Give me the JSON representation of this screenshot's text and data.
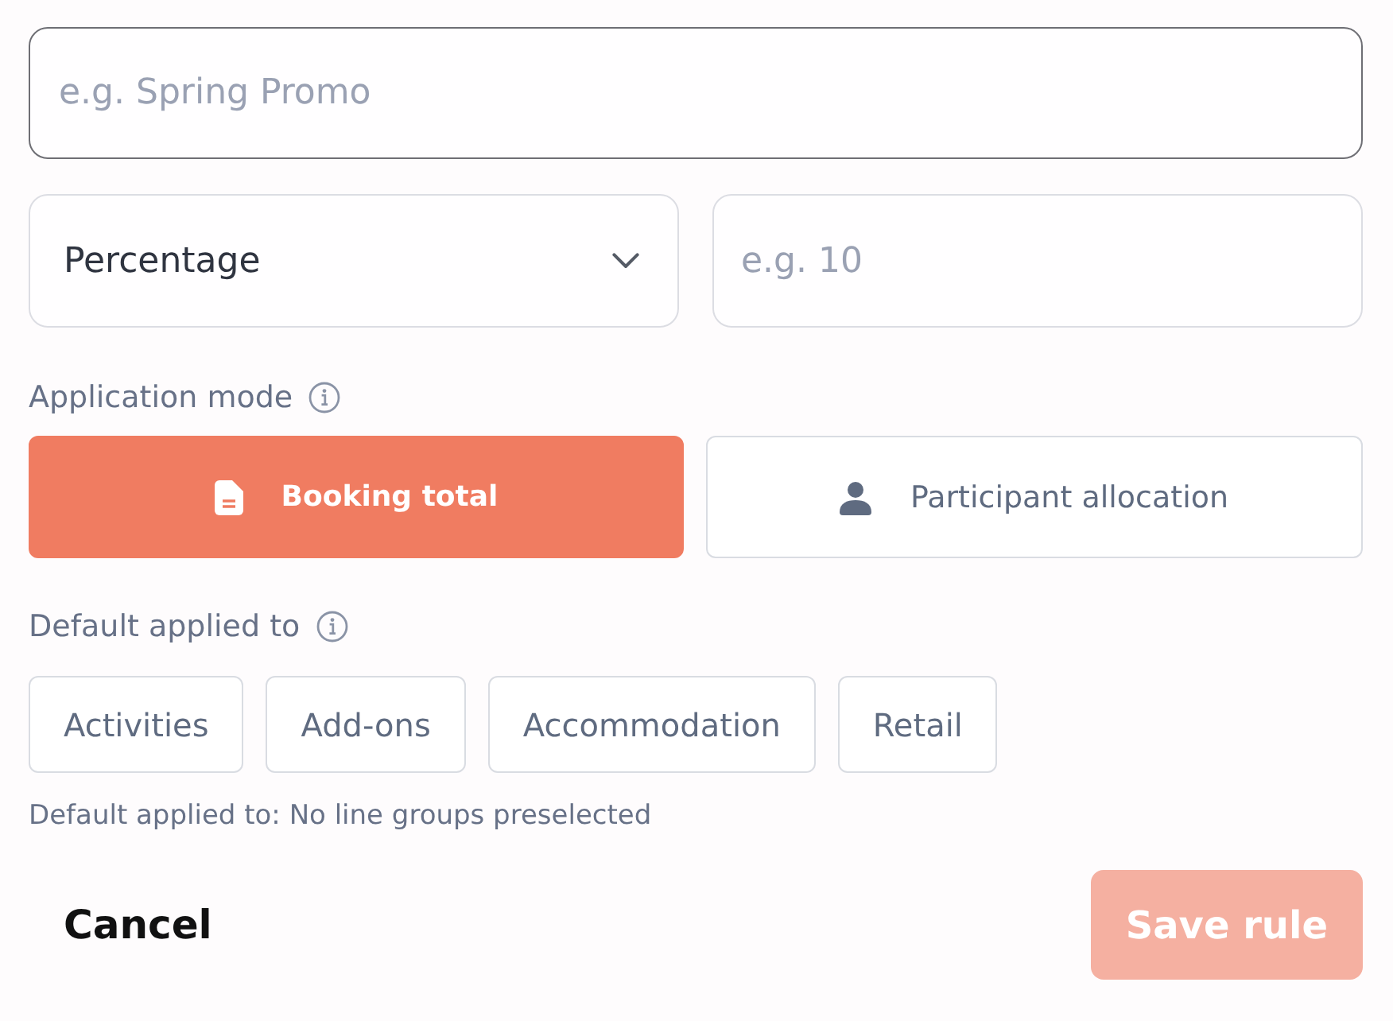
{
  "name_field": {
    "placeholder": "e.g. Spring Promo",
    "focused": true
  },
  "discount": {
    "type_select": {
      "value": "Percentage"
    },
    "amount_field": {
      "placeholder": "e.g. 10"
    }
  },
  "application_mode": {
    "label": "Application mode",
    "options": [
      {
        "label": "Booking total",
        "kind": "document",
        "selected": true
      },
      {
        "label": "Participant allocation",
        "kind": "person",
        "selected": false
      }
    ]
  },
  "default_applied_to": {
    "label": "Default applied to",
    "options": [
      {
        "label": "Activities",
        "selected": false
      },
      {
        "label": "Add-ons",
        "selected": false
      },
      {
        "label": "Accommodation",
        "selected": false
      },
      {
        "label": "Retail",
        "selected": false
      }
    ],
    "helper": "Default applied to: No line groups preselected"
  },
  "actions": {
    "cancel": "Cancel",
    "save": {
      "label": "Save rule",
      "disabled": true
    }
  }
}
